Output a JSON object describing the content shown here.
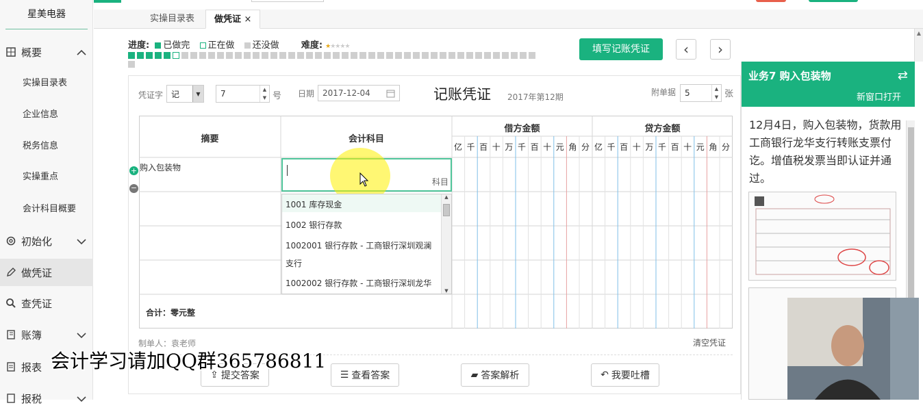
{
  "sidebar": {
    "brand": "星美电器",
    "items": [
      {
        "label": "概要",
        "icon": "grid-icon",
        "expanded": true
      },
      {
        "label": "初始化",
        "icon": "gear-icon"
      },
      {
        "label": "做凭证",
        "icon": "pencil-icon"
      },
      {
        "label": "查凭证",
        "icon": "search-icon"
      },
      {
        "label": "账簿",
        "icon": "book-icon"
      },
      {
        "label": "报表",
        "icon": "doc-icon"
      },
      {
        "label": "报税",
        "icon": "tax-icon"
      }
    ],
    "subitems": [
      "实操目录表",
      "企业信息",
      "税务信息",
      "实操重点",
      "会计科目概要"
    ]
  },
  "tabs": [
    {
      "label": "实操目录表"
    },
    {
      "label": "做凭证",
      "close": "×"
    }
  ],
  "progress": {
    "label": "进度:",
    "done": "已做完",
    "doing": "正在做",
    "todo": "还没做",
    "difficulty": "难度:",
    "done_count": 5,
    "total": 47,
    "difficulty_stars": 1,
    "colors": {
      "done": "#1ab27f",
      "todo": "#cfcfcf"
    }
  },
  "actions": {
    "fill_voucher": "填写记账凭证",
    "prev": "‹",
    "next": "›"
  },
  "voucher": {
    "type_label": "凭证字",
    "type_value": "记",
    "number": "7",
    "number_unit": "号",
    "date_label": "日期",
    "date_value": "2017-12-04",
    "title": "记账凭证",
    "period": "2017年第12期",
    "attach_label": "附单据",
    "attach_value": "5",
    "attach_unit": "张",
    "col_summary": "摘要",
    "col_account": "会计科目",
    "col_debit": "借方金额",
    "col_credit": "贷方金额",
    "digits": [
      "亿",
      "千",
      "百",
      "十",
      "万",
      "千",
      "百",
      "十",
      "元",
      "角",
      "分"
    ],
    "row1_summary": "购入包装物",
    "account_hint": "科目",
    "total_label": "合计：零元整",
    "maker": "制单人：袁老师",
    "clear": "清空凭证"
  },
  "dropdown": {
    "items": [
      "1001 库存现金",
      "1002 银行存款",
      "1002001 银行存款 - 工商银行深圳观澜",
      "支行",
      "1002002 银行存款 - 工商银行深圳龙华"
    ]
  },
  "bottom_buttons": [
    {
      "label": "提交答案"
    },
    {
      "label": "查看答案"
    },
    {
      "label": "答案解析"
    },
    {
      "label": "我要吐槽"
    }
  ],
  "watermark": "会计学习请加QQ群365786811",
  "right_panel": {
    "title": "业务7 购入包装物",
    "open_new": "新窗口打开",
    "description": "12月4日，购入包装物，货款用工商银行龙华支行转账支票付讫。增值税发票当即认证并通过。"
  }
}
